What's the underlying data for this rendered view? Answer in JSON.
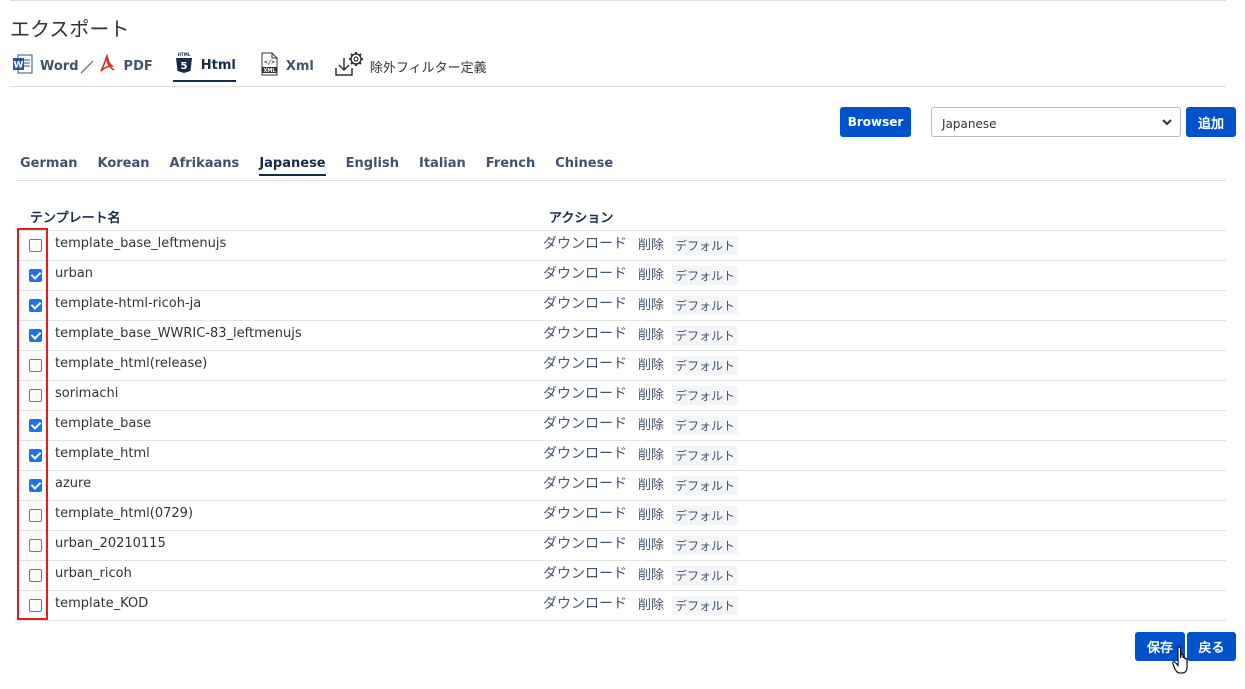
{
  "page": {
    "title": "エクスポート"
  },
  "export_tabs": {
    "word_label": "Word",
    "separator": "／",
    "pdf_label": "PDF",
    "html_label": "Html",
    "xml_label": "Xml",
    "filter_label": "除外フィルター定義",
    "active": "Html"
  },
  "toolbar": {
    "browser_label": "Browser",
    "language_selected": "Japanese",
    "add_label": "追加"
  },
  "language_tabs": [
    "German",
    "Korean",
    "Afrikaans",
    "Japanese",
    "English",
    "Italian",
    "French",
    "Chinese"
  ],
  "active_language": "Japanese",
  "table": {
    "headers": {
      "name": "テンプレート名",
      "actions": "アクション"
    },
    "actions": {
      "download": "ダウンロード",
      "delete": "削除",
      "default": "デフォルト"
    },
    "rows": [
      {
        "name": "template_base_leftmenujs",
        "checked": false
      },
      {
        "name": "urban",
        "checked": true
      },
      {
        "name": "template-html-ricoh-ja",
        "checked": true
      },
      {
        "name": "template_base_WWRIC-83_leftmenujs",
        "checked": true
      },
      {
        "name": "template_html(release)",
        "checked": false
      },
      {
        "name": "sorimachi",
        "checked": false
      },
      {
        "name": "template_base",
        "checked": true
      },
      {
        "name": "template_html",
        "checked": true
      },
      {
        "name": "azure",
        "checked": true
      },
      {
        "name": "template_html(0729)",
        "checked": false
      },
      {
        "name": "urban_20210115",
        "checked": false
      },
      {
        "name": "urban_ricoh",
        "checked": false
      },
      {
        "name": "template_KOD",
        "checked": false
      }
    ]
  },
  "footer": {
    "save_label": "保存",
    "back_label": "戻る"
  },
  "colors": {
    "primary": "#0052cc",
    "checkbox": "#1a73e8",
    "highlight": "#e02020",
    "text": "#42526e"
  }
}
